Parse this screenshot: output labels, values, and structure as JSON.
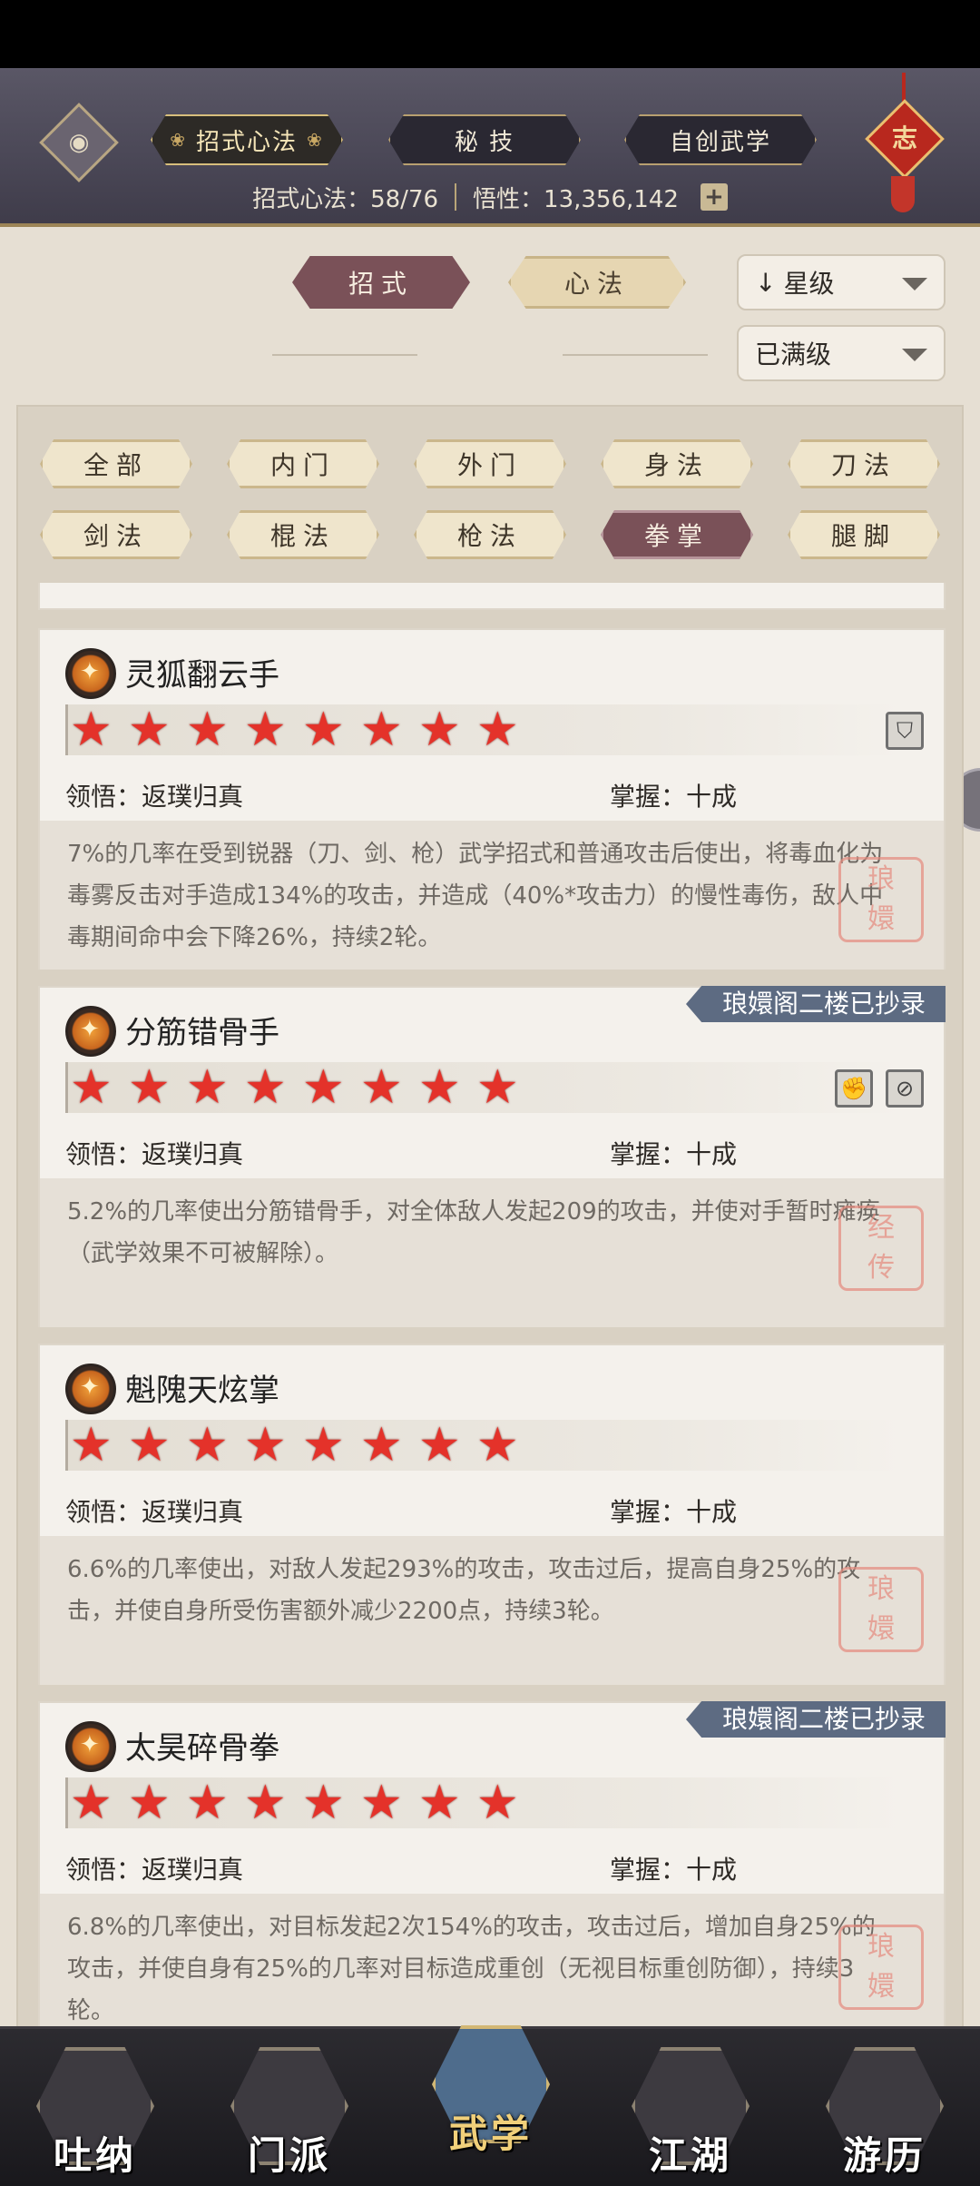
{
  "header": {
    "tabs": [
      {
        "label": "招式心法",
        "active": true
      },
      {
        "label": "秘 技",
        "active": false
      },
      {
        "label": "自创武学",
        "active": false
      }
    ],
    "badge": "志",
    "stats": {
      "moves_label": "招式心法：58/76",
      "insight_label": "悟性：13,356,142"
    }
  },
  "subtabs": {
    "moves": "招式",
    "mind": "心法",
    "sort_dropdown": "星级",
    "level_dropdown": "已满级"
  },
  "categories": [
    "全部",
    "内门",
    "外门",
    "身法",
    "刀法",
    "剑法",
    "棍法",
    "枪法",
    "拳掌",
    "腿脚"
  ],
  "active_category": "拳掌",
  "cards": [
    {
      "title": "灵狐翻云手",
      "stars": 8,
      "comprehension": "领悟：返璞归真",
      "mastery": "掌握：十成",
      "desc": "7%的几率在受到锐器（刀、剑、枪）武学招式和普通攻击后使出，将毒血化为毒雾反击对手造成134%的攻击，并造成（40%*攻击力）的慢性毒伤，敌人中毒期间命中会下降26%，持续2轮。",
      "ribbon": "",
      "icons": [
        "shield-icon"
      ],
      "seal": "琅嬛"
    },
    {
      "title": "分筋错骨手",
      "stars": 8,
      "comprehension": "领悟：返璞归真",
      "mastery": "掌握：十成",
      "desc": "5.2%的几率使出分筋错骨手，对全体敌人发起209的攻击，并使对手暂时瘫痪（武学效果不可被解除）。",
      "ribbon": "琅嬛阁二楼已抄录",
      "icons": [
        "fist-icon",
        "no-heal-icon"
      ],
      "seal": "经传"
    },
    {
      "title": "魁隗天炫掌",
      "stars": 8,
      "comprehension": "领悟：返璞归真",
      "mastery": "掌握：十成",
      "desc": "6.6%的几率使出，对敌人发起293%的攻击，攻击过后，提高自身25%的攻击，并使自身所受伤害额外减少2200点，持续3轮。",
      "ribbon": "",
      "icons": [],
      "seal": "琅嬛"
    },
    {
      "title": "太昊碎骨拳",
      "stars": 8,
      "comprehension": "领悟：返璞归真",
      "mastery": "掌握：十成",
      "desc": "6.8%的几率使出，对目标发起2次154%的攻击，攻击过后，增加自身25%的攻击，并使自身有25%的几率对目标造成重创（无视目标重创防御），持续3轮。",
      "ribbon": "琅嬛阁二楼已抄录",
      "icons": [],
      "seal": "琅嬛"
    }
  ],
  "nav": [
    {
      "label": "吐纳",
      "active": false
    },
    {
      "label": "门派",
      "active": false
    },
    {
      "label": "武学",
      "active": true
    },
    {
      "label": "江湖",
      "active": false
    },
    {
      "label": "游历",
      "active": false
    }
  ]
}
